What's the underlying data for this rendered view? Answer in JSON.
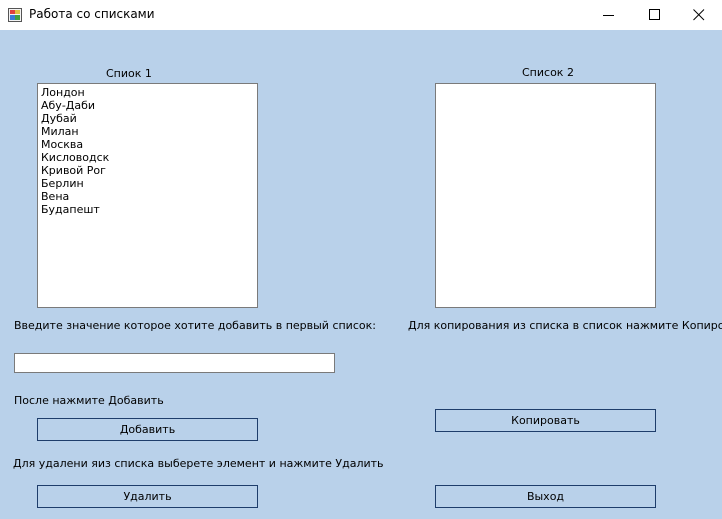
{
  "window": {
    "title": "Работа со списками"
  },
  "list1": {
    "label": "Спиок 1",
    "items": [
      "Лондон",
      "Абу-Даби",
      "Дубай",
      "Милан",
      "Москва",
      "Кисловодск",
      "Кривой Рог",
      "Берлин",
      "Вена",
      "Будапешт"
    ]
  },
  "list2": {
    "label": "Список 2",
    "items": []
  },
  "add": {
    "prompt": "Введите значение которое хотите добавить в первый список:",
    "input_value": "",
    "hint": "После нажмите Добавить",
    "button_label": "Добавить"
  },
  "remove": {
    "hint": "Для удалени яиз списка выберете элемент и нажмите Удалить",
    "button_label": "Удалить"
  },
  "copy": {
    "hint": "Для копирования из списка в список нажмите Копировать",
    "button_label": "Копировать"
  },
  "exit": {
    "button_label": "Выход"
  },
  "icons": {
    "app": "app-window-icon",
    "minimize": "minimize-icon",
    "maximize": "maximize-icon",
    "close": "close-icon"
  }
}
